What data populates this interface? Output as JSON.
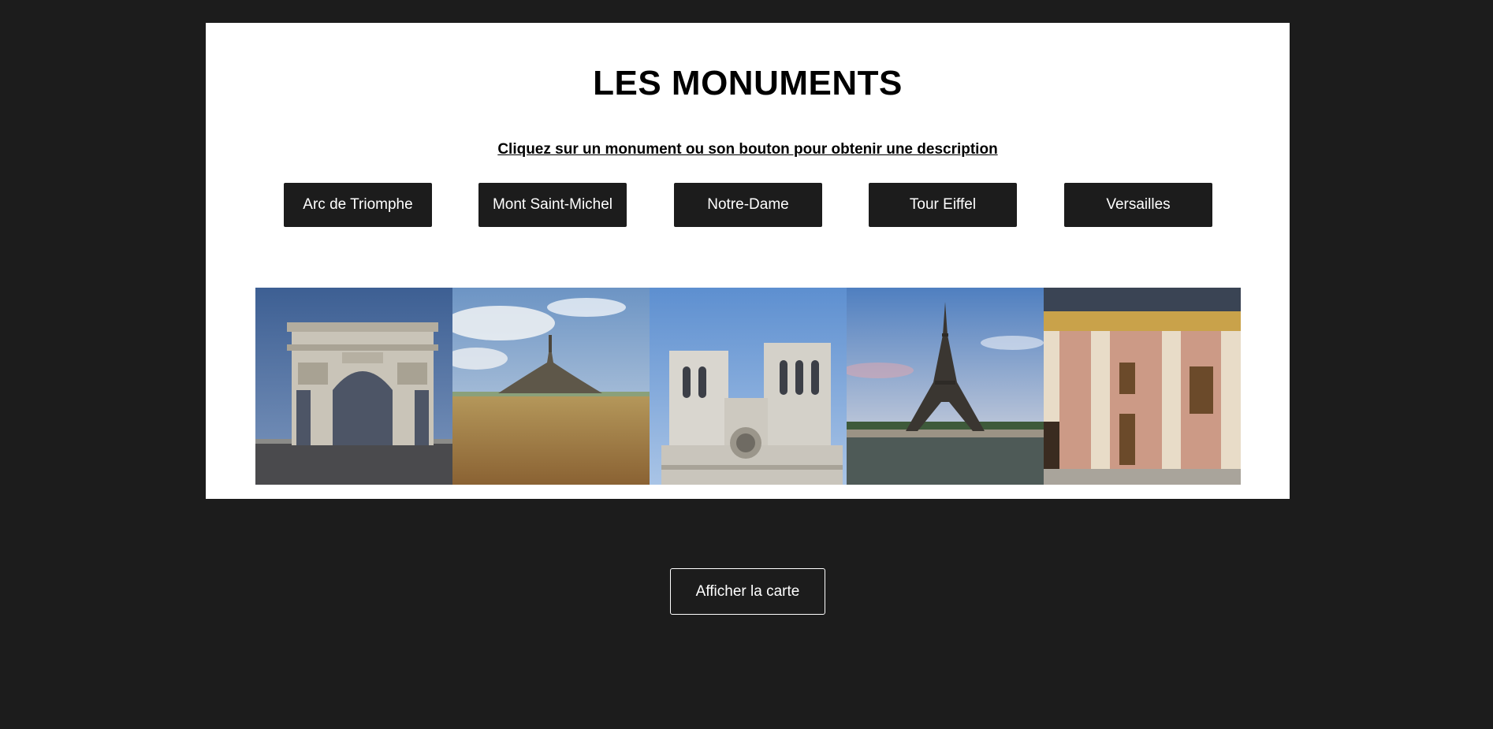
{
  "page": {
    "title": "LES MONUMENTS",
    "instruction": "Cliquez sur un monument ou son bouton pour obtenir une description"
  },
  "monuments": [
    {
      "label": "Arc de Triomphe",
      "icon": "arc-de-triomphe-photo"
    },
    {
      "label": "Mont Saint-Michel",
      "icon": "mont-saint-michel-photo"
    },
    {
      "label": "Notre-Dame",
      "icon": "notre-dame-photo"
    },
    {
      "label": "Tour Eiffel",
      "icon": "tour-eiffel-photo"
    },
    {
      "label": "Versailles",
      "icon": "versailles-photo"
    }
  ],
  "map_button": {
    "label": "Afficher la carte"
  },
  "colors": {
    "background": "#1c1c1c",
    "panel": "#ffffff",
    "button": "#1c1c1c",
    "button_text": "#ffffff"
  }
}
